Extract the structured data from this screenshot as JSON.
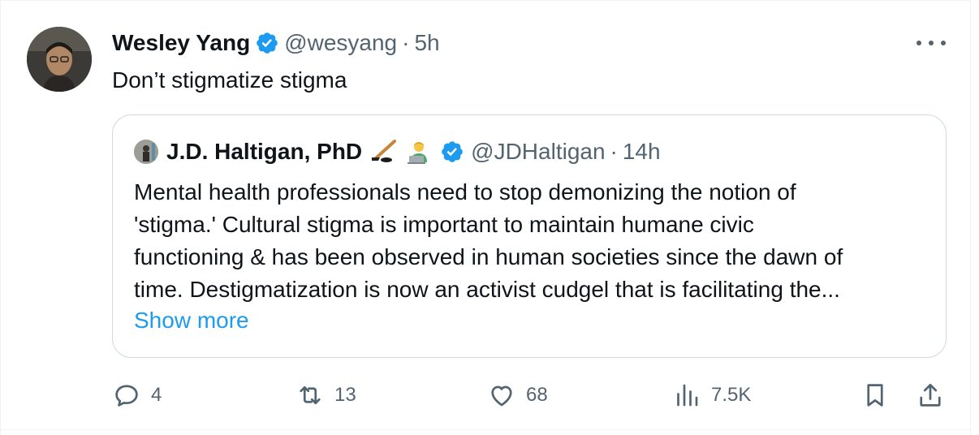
{
  "tweet": {
    "author": {
      "display_name": "Wesley Yang",
      "handle": "@wesyang",
      "time": "5h",
      "verified": true
    },
    "separator": "·",
    "text": "Don’t stigmatize stigma"
  },
  "quote": {
    "author": {
      "display_name": "J.D. Haltigan, PhD",
      "emojis": [
        "hockey-stick-icon",
        "technologist-icon"
      ],
      "handle": "@JDHaltigan",
      "time": "14h",
      "verified": true
    },
    "separator": "·",
    "lines": [
      "Mental health professionals need to stop demonizing the notion of",
      "'stigma.' Cultural stigma is important to maintain humane civic",
      "functioning & has been observed in human societies since the dawn of",
      "time. Destigmatization is now an activist cudgel that is facilitating the..."
    ],
    "show_more": "Show more"
  },
  "actions": {
    "replies": "4",
    "retweets": "13",
    "likes": "68",
    "views": "7.5K"
  },
  "colors": {
    "verified": "#1d9bf0",
    "link": "#1d9bf0",
    "secondary_text": "#536471",
    "border": "#cfd9de"
  }
}
